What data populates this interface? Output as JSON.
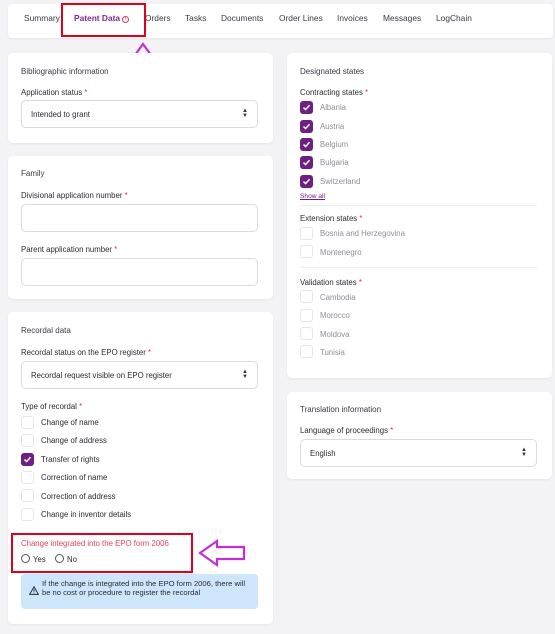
{
  "tabs": [
    {
      "label": "Summary",
      "active": false
    },
    {
      "label": "Patent Data",
      "active": true,
      "icon": "info-circle-icon"
    },
    {
      "label": "Orders",
      "active": false
    },
    {
      "label": "Tasks",
      "active": false
    },
    {
      "label": "Documents",
      "active": false
    },
    {
      "label": "Order Lines",
      "active": false
    },
    {
      "label": "Invoices",
      "active": false
    },
    {
      "label": "Messages",
      "active": false
    },
    {
      "label": "LogChain",
      "active": false
    }
  ],
  "bibliographic": {
    "title": "Bibliographic information",
    "application_status_label": "Application status",
    "application_status_value": "Intended to grant"
  },
  "family": {
    "title": "Family",
    "divisional_label": "Divisional application number",
    "divisional_value": "",
    "parent_label": "Parent application number",
    "parent_value": ""
  },
  "recordal": {
    "title": "Recordal data",
    "status_label": "Recordal status on the EPO register",
    "status_value": "Recordal request visible on EPO register",
    "type_label": "Type of recordal",
    "types": [
      {
        "label": "Change of name",
        "checked": false
      },
      {
        "label": "Change of address",
        "checked": false
      },
      {
        "label": "Transfer of rights",
        "checked": true
      },
      {
        "label": "Correction of name",
        "checked": false
      },
      {
        "label": "Correction of address",
        "checked": false
      },
      {
        "label": "Change in inventor details",
        "checked": false
      }
    ],
    "integrated_label": "Change integrated into the EPO form 2006",
    "yes_label": "Yes",
    "no_label": "No",
    "info_text": "If the change is integrated into the EPO form 2006, there will be no cost or procedure to register the recordal"
  },
  "designated": {
    "title": "Designated states",
    "contracting_label": "Contracting states",
    "contracting": [
      {
        "label": "Albania",
        "checked": true
      },
      {
        "label": "Austria",
        "checked": true
      },
      {
        "label": "Belgium",
        "checked": true
      },
      {
        "label": "Bulgaria",
        "checked": true
      },
      {
        "label": "Switzerland",
        "checked": true
      }
    ],
    "show_all": "Show all",
    "extension_label": "Extension states",
    "extension": [
      {
        "label": "Bosnia and Herzegovina",
        "checked": false
      },
      {
        "label": "Montenegro",
        "checked": false
      }
    ],
    "validation_label": "Validation states",
    "validation": [
      {
        "label": "Cambodia",
        "checked": false
      },
      {
        "label": "Morocco",
        "checked": false
      },
      {
        "label": "Moldova",
        "checked": false
      },
      {
        "label": "Tunisia",
        "checked": false
      }
    ]
  },
  "translation": {
    "title": "Translation information",
    "language_label": "Language of proceedings",
    "language_value": "English"
  },
  "required_mark": "*",
  "colors": {
    "accent": "#6d1f82",
    "required": "#d4344f",
    "highlight": "#e0001b",
    "annotation_arrow": "#c22fd6",
    "info_bg": "#cde6fb"
  }
}
